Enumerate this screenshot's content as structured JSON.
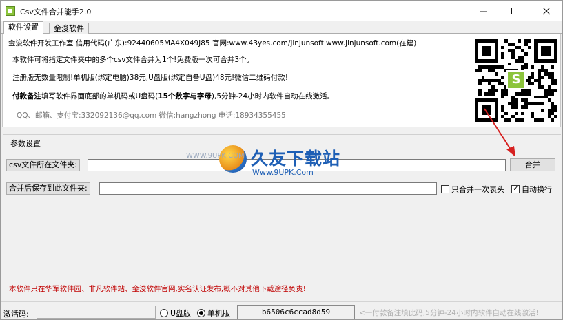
{
  "window": {
    "title": "Csv文件合并能手2.0"
  },
  "tabs": [
    {
      "label": "软件设置"
    },
    {
      "label": "金浚软件"
    }
  ],
  "info": {
    "line1": "金浚软件开发工作室 信用代码(广东):92440605MA4X049J85 官网:www.43yes.com/jinjunsoft  www.jinjunsoft.com(在建)",
    "line2": "本软件可将指定文件夹中的多个csv文件合并为1个!免费版一次可合并3个。",
    "line3": "注册版无数量限制!单机版(绑定电脑)38元,U盘版(绑定自备U盘)48元!微信二维码付款!",
    "line4_bold": "付款备注",
    "line4_mid": "填写软件界面底部的单机码或U盘码(",
    "line4_bold2": "15个数字与字母",
    "line4_end": "),5分钟-24小时内软件自动在线激活。",
    "line5": "QQ、邮箱、支付宝:332092136@qq.com   微信:hangzhong   电话:18934355455"
  },
  "params": {
    "group_title": "参数设置",
    "csv_folder_label": "csv文件所在文件夹:",
    "csv_folder_value": "",
    "save_folder_label": "合并后保存到此文件夹:",
    "save_folder_value": "",
    "merge_button": "合并",
    "merge_header_once": {
      "label": "只合并一次表头",
      "checked": false
    },
    "auto_newline": {
      "label": "自动换行",
      "checked": true
    }
  },
  "notice": "本软件只在华军软件园、非凡软件站、金浚软件官网,实名认证发布,概不对其他下载途径负责!",
  "watermark": {
    "brand": "久友下载站",
    "url": "Www.9UPK.Com",
    "side": "WWW.9UPK.COM"
  },
  "bottom": {
    "activation_label": "激活码:",
    "activation_value": "",
    "usb_label": "U盘版",
    "single_label": "单机版",
    "selected": "single",
    "machine_code": "b6506c6ccad8d59",
    "hint": "<一付款备注填此码,5分钟-24小时内软件自动在线激活!"
  },
  "colors": {
    "notice": "#c00000",
    "watermark": "#1e5fb5",
    "arrow": "#d62020"
  }
}
